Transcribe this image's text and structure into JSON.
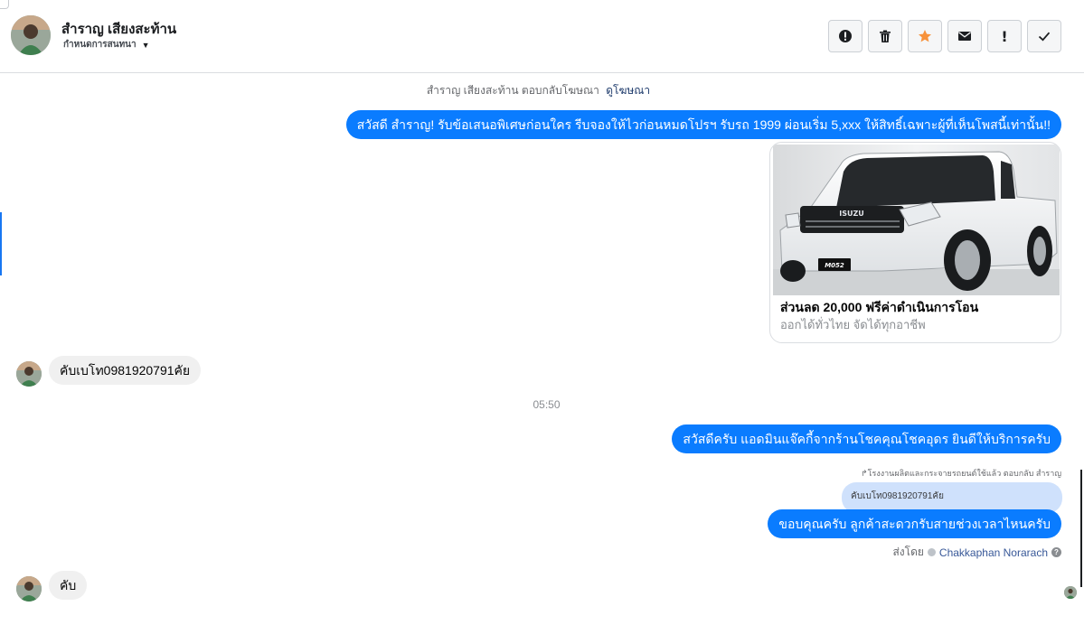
{
  "header": {
    "contact_name": "สำราญ เสียงสะท้าน",
    "label_text": "กำหนดการสนทนา"
  },
  "toolbar": {
    "buttons": [
      {
        "icon": "alert-circle-icon"
      },
      {
        "icon": "trash-icon"
      },
      {
        "icon": "star-icon",
        "color": "#f7923b"
      },
      {
        "icon": "envelope-icon"
      },
      {
        "icon": "exclamation-icon",
        "text": "!"
      },
      {
        "icon": "check-icon"
      }
    ]
  },
  "conversation": {
    "ad_reply_note": "สำราญ เสียงสะท้าน ตอบกลับโฆษณา",
    "ad_reply_link": "ดูโฆษณา",
    "ad_message": "สวัสดี สำราญ! รับข้อเสนอพิเศษก่อนใคร รีบจองให้ไวก่อนหมดโปรฯ รับรถ 1999 ผ่อนเริ่ม 5,xxx ให้สิทธิ์เฉพาะผู้ที่เห็นโพสนี้เท่านั้น!!",
    "ad_card": {
      "title": "ส่วนลด 20,000 ฟรีค่าดำเนินการโอน",
      "subtitle": "ออกได้ทั่วไทย จัดได้ทุกอาชีพ",
      "grille_brand": "ISUZU",
      "plate": "M052"
    },
    "incoming_1": "คับเบโท0981920791คัย",
    "timestamp": "05:50",
    "outgoing_greeting": "สวัสดีครับ แอดมินแจ๊คกี้จากร้านโชคคุณโชคอุดร ยินดีให้บริการครับ",
    "reply_context": "โรงงานผลิตและกระจายรถยนต์ใช้แล้ว ตอบกลับ สำราญ",
    "quoted_message": "คับเบโท0981920791คัย",
    "outgoing_reply": "ขอบคุณครับ ลูกค้าสะดวกรับสายช่วงเวลาไหนครับ",
    "sent_by_label": "ส่งโดย",
    "sent_by_name": "Chakkaphan Norarach",
    "incoming_2": "คับ"
  },
  "colors": {
    "outgoing_bubble": "#0a7cff",
    "incoming_bubble": "#f0f0f0",
    "quote_bubble": "#cfe1fc",
    "star": "#f7923b"
  }
}
